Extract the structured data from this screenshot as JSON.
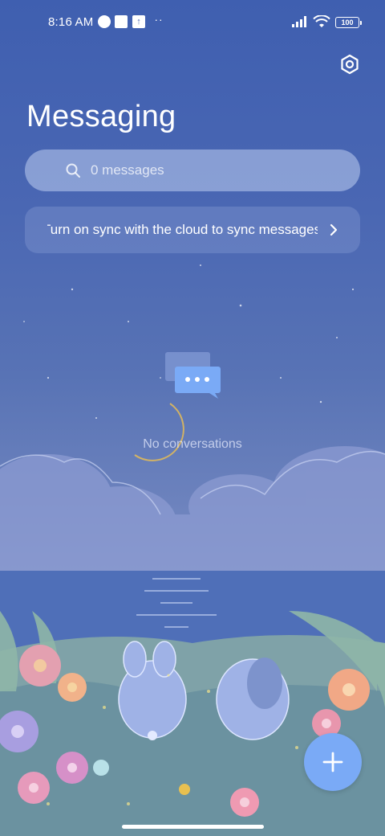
{
  "status_bar": {
    "time": "8:16 AM",
    "battery": "100",
    "icons": [
      "do-not-disturb-icon",
      "notification-square-icon",
      "upload-icon",
      "more-dots-icon",
      "signal-icon",
      "wifi-icon",
      "battery-icon"
    ]
  },
  "header": {
    "title": "Messaging",
    "settings_icon": "settings-icon"
  },
  "search": {
    "placeholder": "0 messages"
  },
  "sync_banner": {
    "text": "Turn on sync with the cloud to sync messages"
  },
  "empty_state": {
    "icon": "chat-bubbles-icon",
    "text": "No conversations"
  },
  "fab": {
    "icon": "plus-icon"
  },
  "colors": {
    "accent": "#7aaaf6",
    "background": "#4a67b3"
  }
}
